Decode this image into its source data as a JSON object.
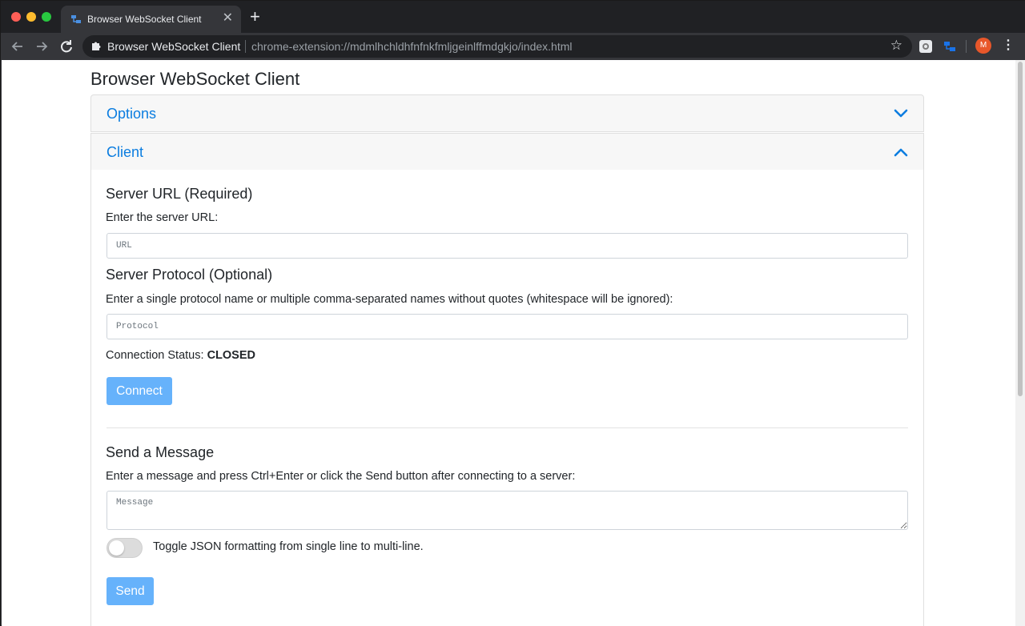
{
  "browser": {
    "tab_title": "Browser WebSocket Client",
    "tab_close": "✕",
    "new_tab": "+",
    "site_name": "Browser WebSocket Client",
    "url": "chrome-extension://mdmlhchldhfnfnkfmljgeinlffmdgkjo/index.html",
    "avatar_initial": "M",
    "icons": {
      "back": "arrow-left-icon",
      "forward": "arrow-right-icon",
      "reload": "reload-icon",
      "star": "star-icon",
      "menu": "vertical-dots-icon"
    },
    "accent_color": "#0b7de0",
    "avatar_color": "#e8572a"
  },
  "page": {
    "title": "Browser WebSocket Client",
    "options_header": "Options",
    "client_header": "Client",
    "server_url": {
      "heading": "Server URL (Required)",
      "label": "Enter the server URL:",
      "placeholder": "URL",
      "value": ""
    },
    "server_protocol": {
      "heading": "Server Protocol (Optional)",
      "label": "Enter a single protocol name or multiple comma-separated names without quotes (whitespace will be ignored):",
      "placeholder": "Protocol",
      "value": ""
    },
    "connection_status": {
      "label": "Connection Status: ",
      "value": "CLOSED"
    },
    "connect_button": "Connect",
    "send_message": {
      "heading": "Send a Message",
      "label": "Enter a message and press Ctrl+Enter or click the Send button after connecting to a server:",
      "placeholder": "Message",
      "value": ""
    },
    "json_toggle": {
      "label": "Toggle JSON formatting from single line to multi-line.",
      "on": false
    },
    "send_button": "Send",
    "button_color": "#66b2fb"
  }
}
